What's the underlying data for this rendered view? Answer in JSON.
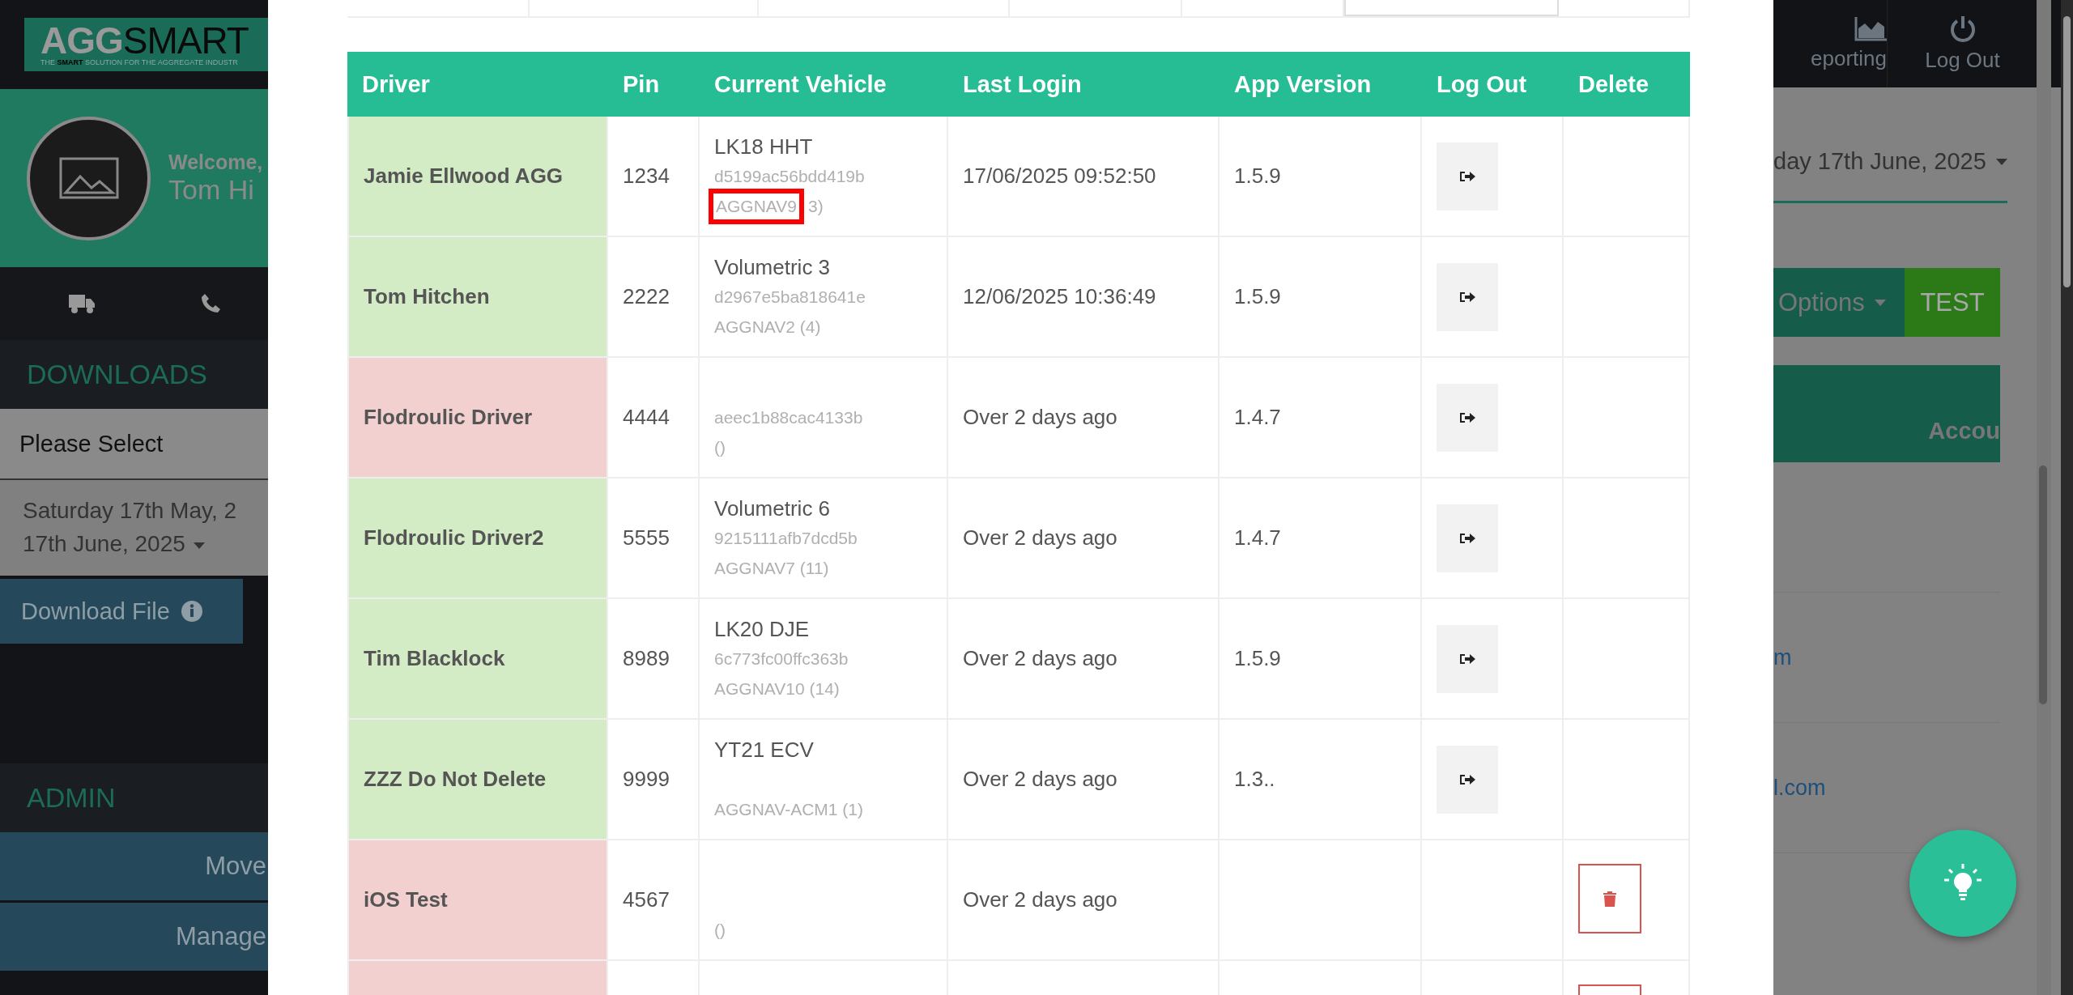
{
  "sidebar": {
    "logo": {
      "brand_a": "AGG",
      "brand_b": "SMART",
      "tagline": "THE **SMART** SOLUTION FOR THE AGGREGATE INDUSTR"
    },
    "welcome": "Welcome,",
    "user": "Tom Hi",
    "downloads_heading": "DOWNLOADS",
    "report_select": {
      "value": "Please Select"
    },
    "date_range": [
      "Saturday 17th May, 2",
      "17th June, 2025"
    ],
    "download_button": "Download File",
    "admin_heading": "ADMIN",
    "admin_items": [
      "Move",
      "Manage"
    ]
  },
  "drivers_table": {
    "columns": [
      "Driver",
      "Pin",
      "Current Vehicle",
      "Last Login",
      "App Version",
      "Log Out",
      "Delete"
    ],
    "rows": [
      {
        "driver": "Jamie Ellwood AGG",
        "pin": "1234",
        "vehicle": "LK18 HHT",
        "device": "d5199ac56bdd419b",
        "nav": "AGGNAV9",
        "nav_suffix": "3)",
        "highlighted": true,
        "last_login": "17/06/2025 09:52:50",
        "app_version": "1.5.9",
        "active": true,
        "log_out_button": true,
        "delete_button": false
      },
      {
        "driver": "Tom Hitchen",
        "pin": "2222",
        "vehicle": "Volumetric 3",
        "device": "d2967e5ba818641e",
        "nav": "AGGNAV2 (4)",
        "highlighted": false,
        "last_login": "12/06/2025 10:36:49",
        "app_version": "1.5.9",
        "active": true,
        "log_out_button": true,
        "delete_button": false
      },
      {
        "driver": "Flodroulic Driver",
        "pin": "4444",
        "device": "aeec1b88cac4133b",
        "nav": "()",
        "highlighted": false,
        "last_login": "Over 2 days ago",
        "app_version": "1.4.7",
        "active": false,
        "log_out_button": true,
        "delete_button": false
      },
      {
        "driver": "Flodroulic Driver2",
        "pin": "5555",
        "vehicle": "Volumetric 6",
        "device": "9215111afb7dcd5b",
        "nav": "AGGNAV7 (11)",
        "highlighted": false,
        "last_login": "Over 2 days ago",
        "app_version": "1.4.7",
        "active": true,
        "log_out_button": true,
        "delete_button": false
      },
      {
        "driver": "Tim Blacklock",
        "pin": "8989",
        "vehicle": "LK20 DJE",
        "device": "6c773fc00ffc363b",
        "nav": "AGGNAV10 (14)",
        "highlighted": false,
        "last_login": "Over 2 days ago",
        "app_version": "1.5.9",
        "active": true,
        "log_out_button": true,
        "delete_button": false
      },
      {
        "driver": "ZZZ Do Not Delete",
        "pin": "9999",
        "vehicle": "YT21 ECV",
        "nav": "AGGNAV-ACM1 (1)",
        "highlighted": false,
        "last_login": "Over 2 days ago",
        "app_version": "1.3..",
        "active": true,
        "log_out_button": true,
        "delete_button": false
      },
      {
        "driver": "iOS Test",
        "pin": "4567",
        "nav": "()",
        "highlighted": false,
        "last_login": "Over 2 days ago",
        "active": false,
        "log_out_button": false,
        "delete_button": true
      },
      {
        "active": false,
        "log_out_button": false,
        "delete_button": true
      }
    ]
  },
  "right_panel": {
    "nav": [
      {
        "label": "eporting",
        "kind": "chart"
      },
      {
        "label": "Log Out",
        "kind": "power"
      }
    ],
    "date": "day 17th June, 2025",
    "options_button": "Options",
    "test_button": "TEST",
    "table_heading": "Accou",
    "links": [
      "m",
      "l.com"
    ]
  }
}
